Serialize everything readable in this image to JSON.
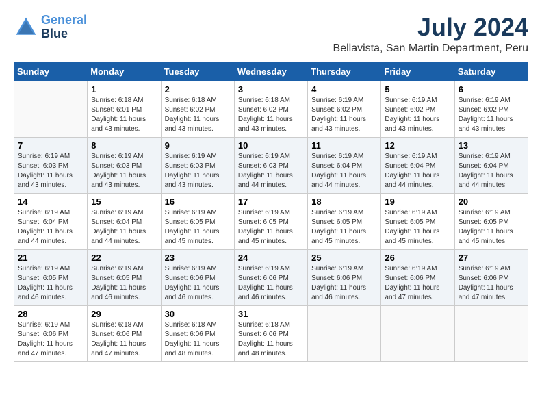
{
  "header": {
    "logo_line1": "General",
    "logo_line2": "Blue",
    "month_year": "July 2024",
    "location": "Bellavista, San Martin Department, Peru"
  },
  "weekdays": [
    "Sunday",
    "Monday",
    "Tuesday",
    "Wednesday",
    "Thursday",
    "Friday",
    "Saturday"
  ],
  "weeks": [
    [
      {
        "day": "",
        "info": ""
      },
      {
        "day": "1",
        "info": "Sunrise: 6:18 AM\nSunset: 6:01 PM\nDaylight: 11 hours\nand 43 minutes."
      },
      {
        "day": "2",
        "info": "Sunrise: 6:18 AM\nSunset: 6:02 PM\nDaylight: 11 hours\nand 43 minutes."
      },
      {
        "day": "3",
        "info": "Sunrise: 6:18 AM\nSunset: 6:02 PM\nDaylight: 11 hours\nand 43 minutes."
      },
      {
        "day": "4",
        "info": "Sunrise: 6:19 AM\nSunset: 6:02 PM\nDaylight: 11 hours\nand 43 minutes."
      },
      {
        "day": "5",
        "info": "Sunrise: 6:19 AM\nSunset: 6:02 PM\nDaylight: 11 hours\nand 43 minutes."
      },
      {
        "day": "6",
        "info": "Sunrise: 6:19 AM\nSunset: 6:02 PM\nDaylight: 11 hours\nand 43 minutes."
      }
    ],
    [
      {
        "day": "7",
        "info": "Sunrise: 6:19 AM\nSunset: 6:03 PM\nDaylight: 11 hours\nand 43 minutes."
      },
      {
        "day": "8",
        "info": "Sunrise: 6:19 AM\nSunset: 6:03 PM\nDaylight: 11 hours\nand 43 minutes."
      },
      {
        "day": "9",
        "info": "Sunrise: 6:19 AM\nSunset: 6:03 PM\nDaylight: 11 hours\nand 43 minutes."
      },
      {
        "day": "10",
        "info": "Sunrise: 6:19 AM\nSunset: 6:03 PM\nDaylight: 11 hours\nand 44 minutes."
      },
      {
        "day": "11",
        "info": "Sunrise: 6:19 AM\nSunset: 6:04 PM\nDaylight: 11 hours\nand 44 minutes."
      },
      {
        "day": "12",
        "info": "Sunrise: 6:19 AM\nSunset: 6:04 PM\nDaylight: 11 hours\nand 44 minutes."
      },
      {
        "day": "13",
        "info": "Sunrise: 6:19 AM\nSunset: 6:04 PM\nDaylight: 11 hours\nand 44 minutes."
      }
    ],
    [
      {
        "day": "14",
        "info": "Sunrise: 6:19 AM\nSunset: 6:04 PM\nDaylight: 11 hours\nand 44 minutes."
      },
      {
        "day": "15",
        "info": "Sunrise: 6:19 AM\nSunset: 6:04 PM\nDaylight: 11 hours\nand 44 minutes."
      },
      {
        "day": "16",
        "info": "Sunrise: 6:19 AM\nSunset: 6:05 PM\nDaylight: 11 hours\nand 45 minutes."
      },
      {
        "day": "17",
        "info": "Sunrise: 6:19 AM\nSunset: 6:05 PM\nDaylight: 11 hours\nand 45 minutes."
      },
      {
        "day": "18",
        "info": "Sunrise: 6:19 AM\nSunset: 6:05 PM\nDaylight: 11 hours\nand 45 minutes."
      },
      {
        "day": "19",
        "info": "Sunrise: 6:19 AM\nSunset: 6:05 PM\nDaylight: 11 hours\nand 45 minutes."
      },
      {
        "day": "20",
        "info": "Sunrise: 6:19 AM\nSunset: 6:05 PM\nDaylight: 11 hours\nand 45 minutes."
      }
    ],
    [
      {
        "day": "21",
        "info": "Sunrise: 6:19 AM\nSunset: 6:05 PM\nDaylight: 11 hours\nand 46 minutes."
      },
      {
        "day": "22",
        "info": "Sunrise: 6:19 AM\nSunset: 6:05 PM\nDaylight: 11 hours\nand 46 minutes."
      },
      {
        "day": "23",
        "info": "Sunrise: 6:19 AM\nSunset: 6:06 PM\nDaylight: 11 hours\nand 46 minutes."
      },
      {
        "day": "24",
        "info": "Sunrise: 6:19 AM\nSunset: 6:06 PM\nDaylight: 11 hours\nand 46 minutes."
      },
      {
        "day": "25",
        "info": "Sunrise: 6:19 AM\nSunset: 6:06 PM\nDaylight: 11 hours\nand 46 minutes."
      },
      {
        "day": "26",
        "info": "Sunrise: 6:19 AM\nSunset: 6:06 PM\nDaylight: 11 hours\nand 47 minutes."
      },
      {
        "day": "27",
        "info": "Sunrise: 6:19 AM\nSunset: 6:06 PM\nDaylight: 11 hours\nand 47 minutes."
      }
    ],
    [
      {
        "day": "28",
        "info": "Sunrise: 6:19 AM\nSunset: 6:06 PM\nDaylight: 11 hours\nand 47 minutes."
      },
      {
        "day": "29",
        "info": "Sunrise: 6:18 AM\nSunset: 6:06 PM\nDaylight: 11 hours\nand 47 minutes."
      },
      {
        "day": "30",
        "info": "Sunrise: 6:18 AM\nSunset: 6:06 PM\nDaylight: 11 hours\nand 48 minutes."
      },
      {
        "day": "31",
        "info": "Sunrise: 6:18 AM\nSunset: 6:06 PM\nDaylight: 11 hours\nand 48 minutes."
      },
      {
        "day": "",
        "info": ""
      },
      {
        "day": "",
        "info": ""
      },
      {
        "day": "",
        "info": ""
      }
    ]
  ]
}
